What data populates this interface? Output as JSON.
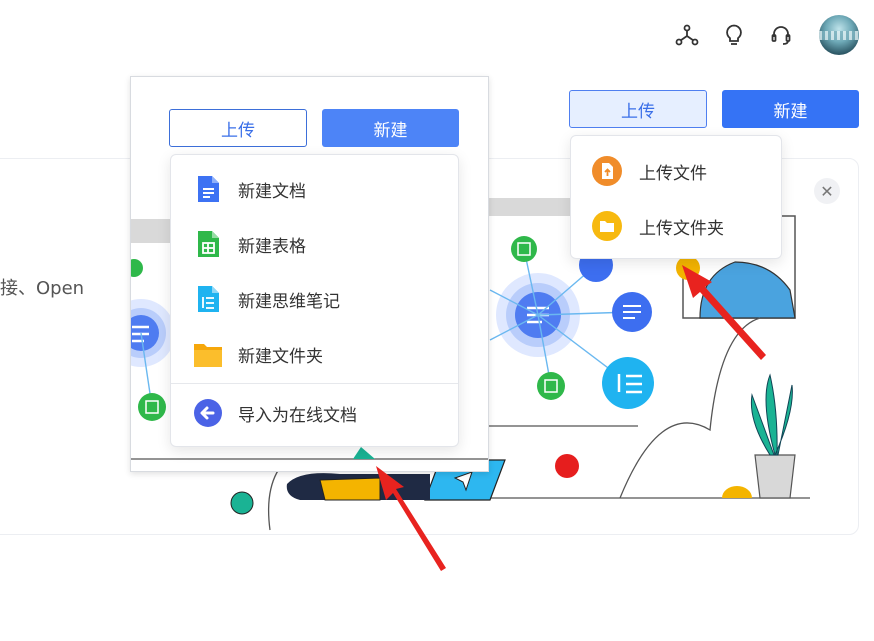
{
  "header": {
    "icons": [
      "network-icon",
      "lightbulb-icon",
      "headset-icon",
      "avatar"
    ]
  },
  "toolbar": {
    "upload_label": "上传",
    "new_label": "新建"
  },
  "card": {
    "partial_text": "接、Open"
  },
  "zoom_panel": {
    "upload_label": "上传",
    "new_label": "新建"
  },
  "new_menu": {
    "items": [
      {
        "label": "新建文档",
        "icon": "doc-icon"
      },
      {
        "label": "新建表格",
        "icon": "sheet-icon"
      },
      {
        "label": "新建思维笔记",
        "icon": "mindnote-icon"
      },
      {
        "label": "新建文件夹",
        "icon": "folder-icon"
      },
      {
        "label": "导入为在线文档",
        "icon": "import-icon"
      }
    ]
  },
  "upload_menu": {
    "items": [
      {
        "label": "上传文件",
        "icon": "upload-file-icon"
      },
      {
        "label": "上传文件夹",
        "icon": "upload-folder-icon"
      }
    ]
  },
  "colors": {
    "primary": "#3573f5",
    "annotation_arrow": "#e8231f"
  }
}
